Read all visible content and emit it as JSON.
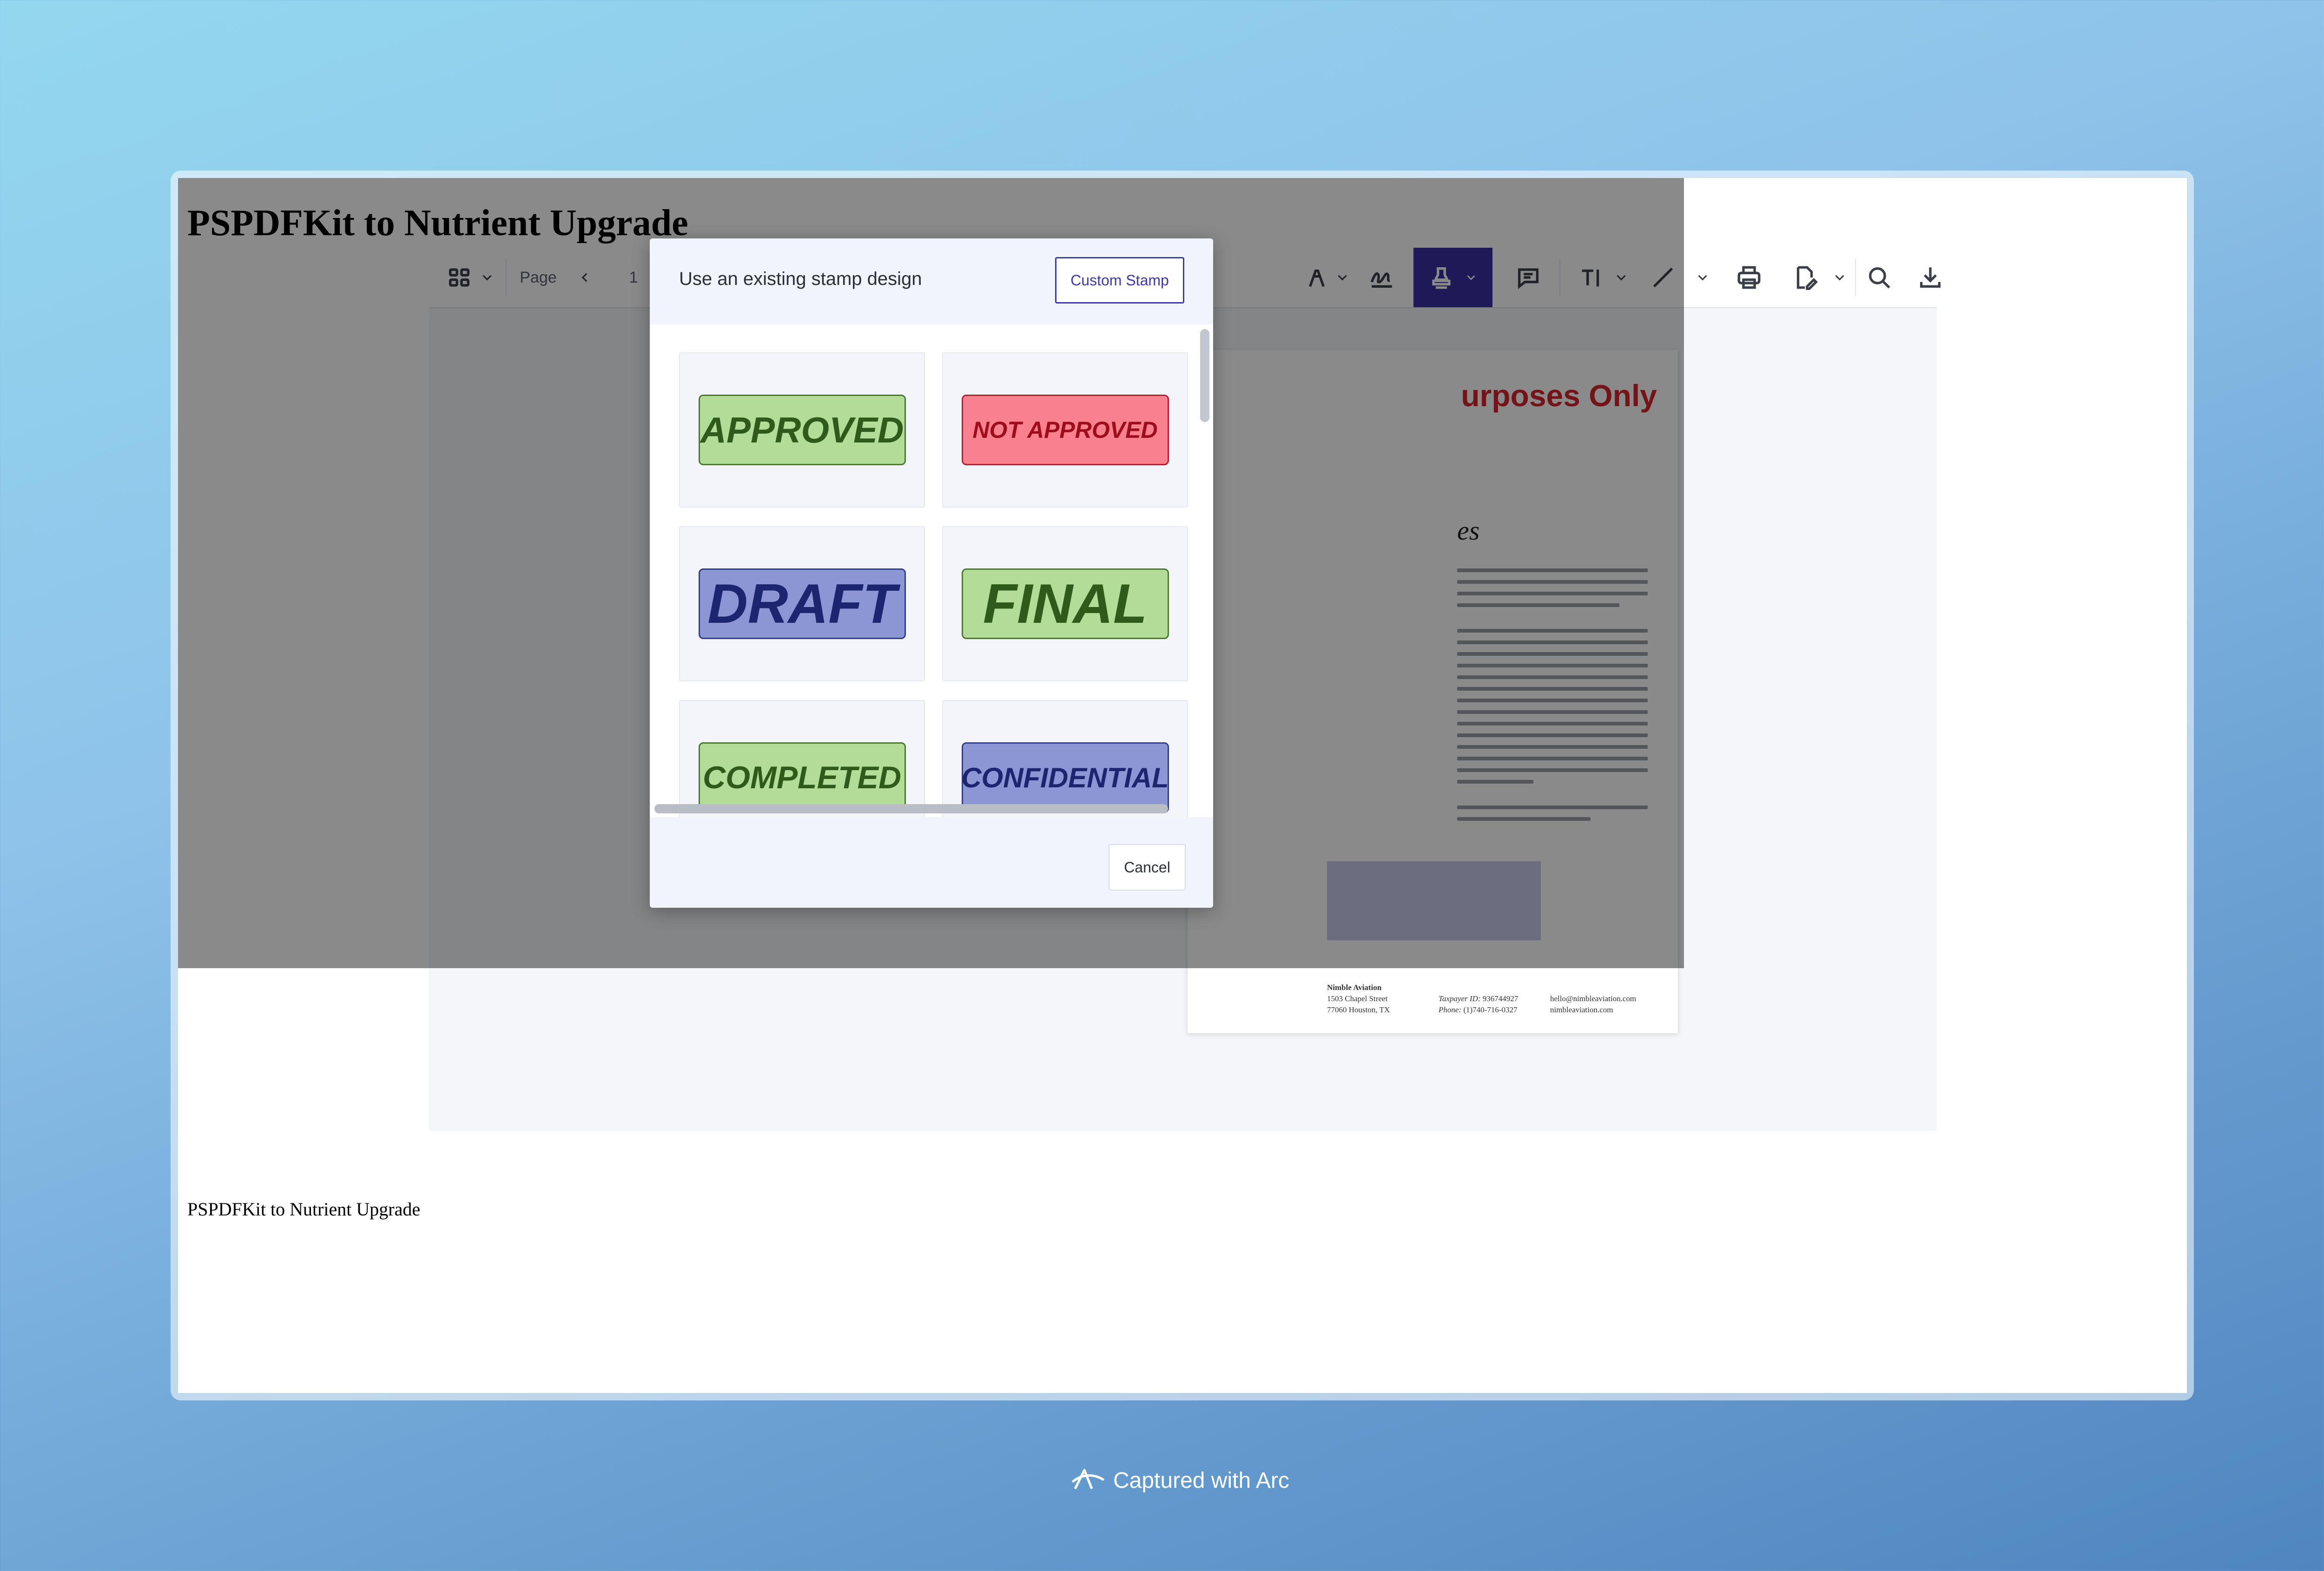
{
  "page": {
    "title": "PSPDFKit to Nutrient Upgrade",
    "footer_text": "PSPDFKit to Nutrient Upgrade"
  },
  "toolbar": {
    "page_label": "Page",
    "page_number": "1",
    "icons": [
      "thumbnails-icon",
      "chevron-down-icon",
      "previous-page-icon",
      "ink-pen-icon",
      "signature-icon",
      "stamp-icon",
      "comment-icon",
      "text-icon",
      "line-icon",
      "print-icon",
      "edit-document-icon",
      "search-icon",
      "download-icon"
    ],
    "active_tool": "stamp",
    "active_color": "#3a2fa3"
  },
  "document": {
    "heading": "urposes Only",
    "subheading": "es",
    "footer": {
      "company": "Nimble Aviation",
      "address_line1": "1503 Chapel Street",
      "address_line2": "77060 Houston, TX",
      "taxpayer_label": "Taxpayer ID:",
      "taxpayer_id": "936744927",
      "phone_label": "Phone:",
      "phone": "(1)740-716-0327",
      "email": "hello@nimbleaviation.com",
      "website": "nimbleaviation.com"
    }
  },
  "modal": {
    "title": "Use an existing stamp design",
    "custom_stamp_label": "Custom Stamp",
    "cancel_label": "Cancel",
    "stamps": [
      {
        "label": "APPROVED",
        "style": "green"
      },
      {
        "label": "NOT APPROVED",
        "style": "red"
      },
      {
        "label": "DRAFT",
        "style": "blue"
      },
      {
        "label": "FINAL",
        "style": "green"
      },
      {
        "label": "COMPLETED",
        "style": "green"
      },
      {
        "label": "CONFIDENTIAL",
        "style": "blue"
      }
    ]
  },
  "capture": {
    "label": "Captured with Arc"
  }
}
